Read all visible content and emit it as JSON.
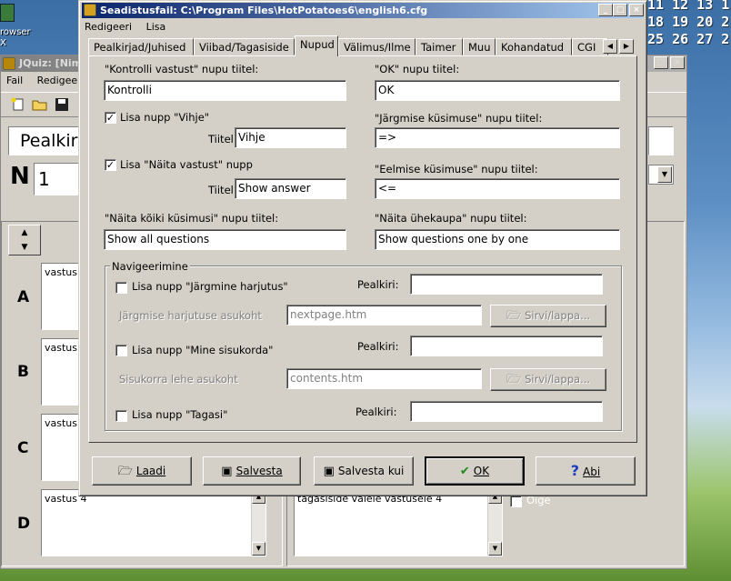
{
  "desktop": {
    "icon_label_1": "rowser",
    "icon_label_2": "X",
    "calendar_row1": "11 12 13 1",
    "calendar_row2": "18 19 20 2",
    "calendar_row3": "25 26 27 2"
  },
  "bg_window": {
    "title": "JQuiz: [Nime",
    "menu": [
      "Fail",
      "Redigeeri"
    ],
    "title_field": "Pealkir",
    "question_label": "N",
    "question_number": "1",
    "answers": [
      {
        "letter": "A",
        "text": "vastus"
      },
      {
        "letter": "B",
        "text": "vastus"
      },
      {
        "letter": "C",
        "text": "vastus"
      },
      {
        "letter": "D",
        "text": "vastus 4"
      }
    ],
    "feedback_d": "tagasiside valele vastusele 4",
    "correct_label": "Õige"
  },
  "dialog": {
    "title": "Seadistusfail: C:\\Program Files\\HotPotatoes6\\english6.cfg",
    "menu": [
      "Redigeeri",
      "Lisa"
    ],
    "tabs": [
      "Pealkirjad/Juhised",
      "Viibad/Tagasiside",
      "Nupud",
      "Välimus/Ilme",
      "Taimer",
      "Muu",
      "Kohandatud",
      "CGI"
    ],
    "active_tab": "Nupud",
    "check_label": "Kontrolli vastust\" nupu tiitel:",
    "check_label_full": "\"Kontrolli vastust\" nupu tiitel:",
    "check_value": "Kontrolli",
    "ok_label": "\"OK\" nupu tiitel:",
    "ok_value": "OK",
    "hint_check": "Lisa nupp \"Vihje\"",
    "hint_title_label": "Tiitel:",
    "hint_value": "Vihje",
    "next_q_label": "\"Järgmise küsimuse\" nupu tiitel:",
    "next_q_value": "=>",
    "show_answer_check": "Lisa \"Näita vastust\" nupp",
    "show_answer_title_label": "Tiitel:",
    "show_answer_value": "Show answer",
    "prev_q_label": "\"Eelmise küsimuse\" nupu tiitel:",
    "prev_q_value": "<=",
    "show_all_label": "\"Näita kõiki küsimusi\" nupu tiitel:",
    "show_all_value": "Show all questions",
    "show_one_label": "\"Näita ühekaupa\" nupu tiitel:",
    "show_one_value": "Show questions one by one",
    "nav_group": "Navigeerimine",
    "next_ex_check": "Lisa nupp \"Järgmine harjutus\"",
    "next_ex_caption_label": "Pealkiri:",
    "next_ex_caption": "",
    "next_ex_loc_label": "Järgmise harjutuse asukoht",
    "next_ex_loc": "nextpage.htm",
    "browse_label": "Sirvi/lappa...",
    "contents_check": "Lisa nupp \"Mine sisukorda\"",
    "contents_caption_label": "Pealkiri:",
    "contents_caption": "",
    "contents_loc_label": "Sisukorra lehe asukoht",
    "contents_loc": "contents.htm",
    "back_check": "Lisa nupp \"Tagasi\"",
    "back_caption_label": "Pealkiri:",
    "back_caption": "",
    "hint_checked": true,
    "show_answer_checked": true,
    "buttons": {
      "load": "Laadi",
      "save": "Salvesta",
      "save_as": "Salvesta kui",
      "ok": "OK",
      "help": "Abi"
    }
  },
  "colors": {
    "titlebar_active": "#0a246a",
    "face": "#d4d0c8",
    "ok_check": "#1a8a1a",
    "help_icon": "#1a3fbf"
  }
}
